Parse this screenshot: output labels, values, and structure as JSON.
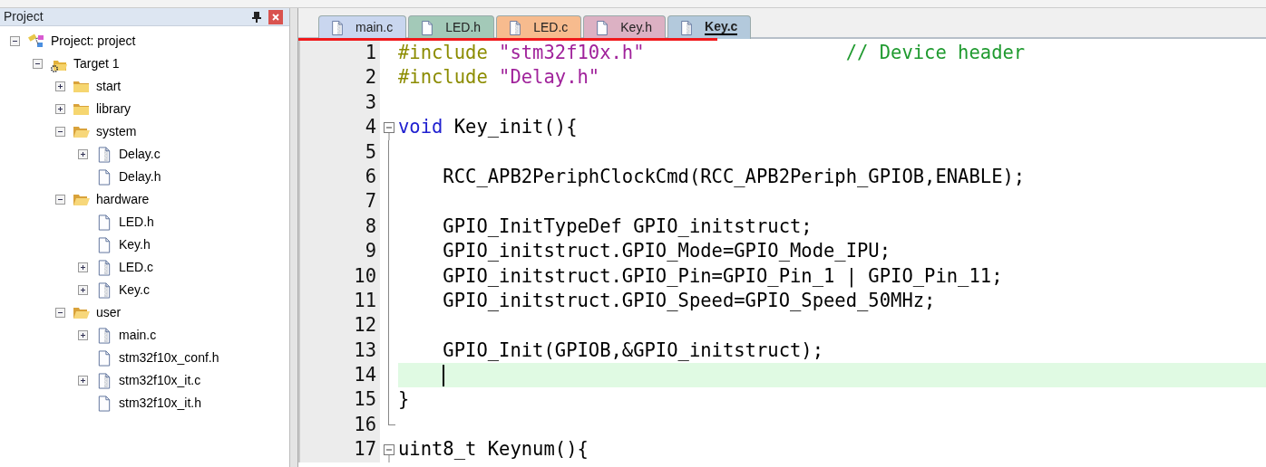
{
  "project_panel": {
    "title": "Project",
    "tree": [
      {
        "label": "Project: project",
        "kind": "project",
        "expanded": true,
        "children": [
          {
            "label": "Target 1",
            "kind": "target",
            "expanded": true,
            "children": [
              {
                "label": "start",
                "kind": "folder",
                "expanded": false
              },
              {
                "label": "library",
                "kind": "folder",
                "expanded": false
              },
              {
                "label": "system",
                "kind": "folder",
                "expanded": true,
                "children": [
                  {
                    "label": "Delay.c",
                    "kind": "source",
                    "expanded": false
                  },
                  {
                    "label": "Delay.h",
                    "kind": "header"
                  }
                ]
              },
              {
                "label": "hardware",
                "kind": "folder",
                "expanded": true,
                "children": [
                  {
                    "label": "LED.h",
                    "kind": "header"
                  },
                  {
                    "label": "Key.h",
                    "kind": "header"
                  },
                  {
                    "label": "LED.c",
                    "kind": "source",
                    "expanded": false
                  },
                  {
                    "label": "Key.c",
                    "kind": "source",
                    "expanded": false
                  }
                ]
              },
              {
                "label": "user",
                "kind": "folder",
                "expanded": true,
                "children": [
                  {
                    "label": "main.c",
                    "kind": "source",
                    "expanded": false
                  },
                  {
                    "label": "stm32f10x_conf.h",
                    "kind": "header"
                  },
                  {
                    "label": "stm32f10x_it.c",
                    "kind": "source",
                    "expanded": false
                  },
                  {
                    "label": "stm32f10x_it.h",
                    "kind": "header"
                  }
                ]
              }
            ]
          }
        ]
      }
    ]
  },
  "tabs": [
    {
      "label": "main.c",
      "kind": "source",
      "color": "#c9d6ef",
      "selected": false
    },
    {
      "label": "LED.h",
      "kind": "header",
      "color": "#a3c9b8",
      "selected": false
    },
    {
      "label": "LED.c",
      "kind": "source",
      "color": "#f7bb8e",
      "selected": false
    },
    {
      "label": "Key.h",
      "kind": "header",
      "color": "#dcb1c3",
      "selected": false
    },
    {
      "label": "Key.c",
      "kind": "source",
      "color": "#b3c9dc",
      "selected": true
    }
  ],
  "editor": {
    "lines": [
      {
        "number": "1",
        "kind": "plain",
        "current": false,
        "tokens": [
          {
            "text": "#include ",
            "kind": "pre"
          },
          {
            "text": "\"stm32f10x.h\"",
            "kind": "string"
          },
          {
            "text": "                  // Device header",
            "kind": "comment"
          }
        ]
      },
      {
        "number": "2",
        "kind": "plain",
        "current": false,
        "tokens": [
          {
            "text": "#include ",
            "kind": "pre"
          },
          {
            "text": "\"Delay.h\"",
            "kind": "string"
          }
        ]
      },
      {
        "number": "3",
        "kind": "plain",
        "current": false
      },
      {
        "number": "4",
        "kind": "fold_start",
        "current": false,
        "tokens": [
          {
            "text": "void",
            "kind": "keyword"
          },
          {
            "text": " Key_init(){",
            "kind": "plain"
          }
        ]
      },
      {
        "number": "5",
        "kind": "fold_body",
        "current": false
      },
      {
        "number": "6",
        "kind": "fold_body",
        "current": false,
        "tokens": [
          {
            "text": "    RCC_APB2PeriphClockCmd(RCC_APB2Periph_GPIOB,ENABLE);",
            "kind": "plain"
          }
        ]
      },
      {
        "number": "7",
        "kind": "fold_body",
        "current": false
      },
      {
        "number": "8",
        "kind": "fold_body",
        "current": false,
        "tokens": [
          {
            "text": "    GPIO_InitTypeDef GPIO_initstruct;",
            "kind": "plain"
          }
        ]
      },
      {
        "number": "9",
        "kind": "fold_body",
        "current": false,
        "tokens": [
          {
            "text": "    GPIO_initstruct.GPIO_Mode=GPIO_Mode_IPU;",
            "kind": "plain"
          }
        ]
      },
      {
        "number": "10",
        "kind": "fold_body",
        "current": false,
        "tokens": [
          {
            "text": "    GPIO_initstruct.GPIO_Pin=GPIO_Pin_1 | GPIO_Pin_11;",
            "kind": "plain"
          }
        ]
      },
      {
        "number": "11",
        "kind": "fold_body",
        "current": false,
        "tokens": [
          {
            "text": "    GPIO_initstruct.GPIO_Speed=GPIO_Speed_50MHz;",
            "kind": "plain"
          }
        ]
      },
      {
        "number": "12",
        "kind": "fold_body",
        "current": false
      },
      {
        "number": "13",
        "kind": "fold_body",
        "current": false,
        "tokens": [
          {
            "text": "    GPIO_Init(GPIOB,&GPIO_initstruct);",
            "kind": "plain"
          }
        ]
      },
      {
        "number": "14",
        "kind": "fold_body",
        "current": true
      },
      {
        "number": "15",
        "kind": "fold_body",
        "current": false,
        "tokens": [
          {
            "text": "}",
            "kind": "plain"
          }
        ]
      },
      {
        "number": "16",
        "kind": "fold_end",
        "current": false
      },
      {
        "number": "17",
        "kind": "fold_start",
        "current": false,
        "tokens": [
          {
            "text": "uint8_t Keynum(){",
            "kind": "plain"
          }
        ]
      }
    ]
  }
}
